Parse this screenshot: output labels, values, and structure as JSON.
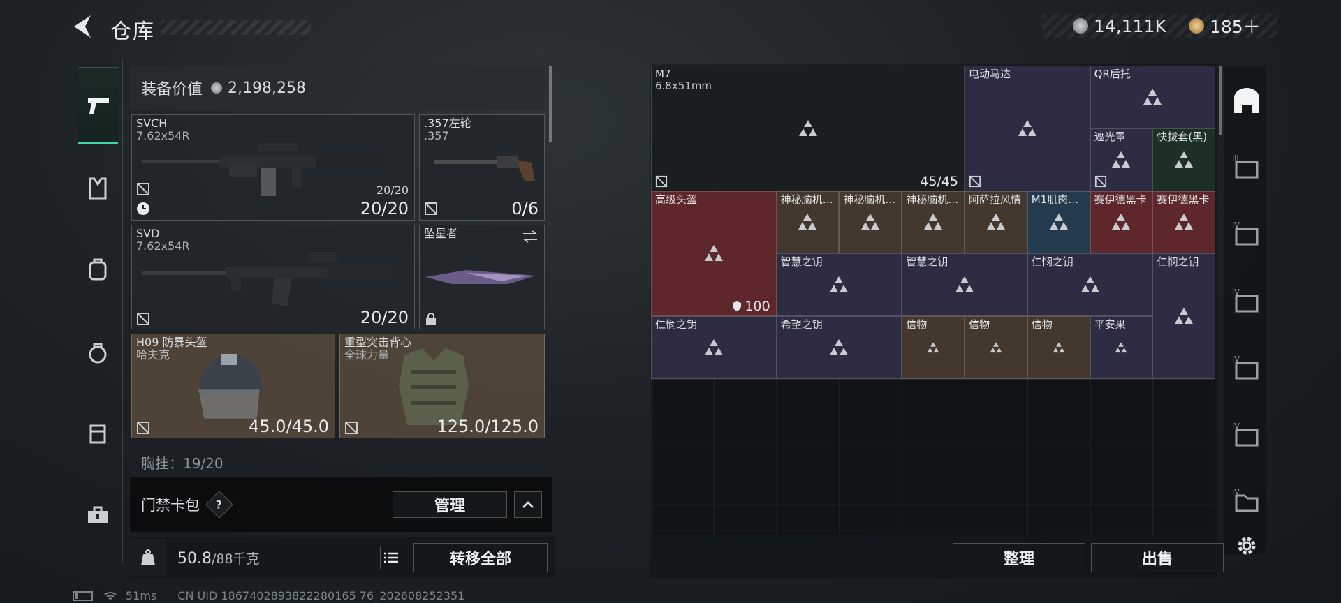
{
  "header": {
    "title": "仓库",
    "currency_silver": "14,111K",
    "currency_gold": "185＋"
  },
  "equipment": {
    "value_label": "装备价值",
    "value": "2,198,258",
    "primary": {
      "name": "SVCH",
      "caliber": "7.62x54R",
      "mag": "20/20",
      "ammo": "20/20"
    },
    "sidearm": {
      "name": ".357左轮",
      "caliber": ".357",
      "ammo": "0/6"
    },
    "secondary": {
      "name": "SVD",
      "caliber": "7.62x54R",
      "ammo": "20/20"
    },
    "melee": {
      "name": "坠星者"
    },
    "helmet": {
      "name": "H09 防暴头盔",
      "brand": "哈夫克",
      "durability": "45.0/45.0"
    },
    "armor": {
      "name": "重型突击背心",
      "brand": "全球力量",
      "durability": "125.0/125.0"
    },
    "chest_rig_label": "胸挂：19/20"
  },
  "card_pack": {
    "label": "门禁卡包",
    "help": "?",
    "manage": "管理"
  },
  "weight": {
    "current": "50.8",
    "max": "/88千克",
    "transfer_all": "转移全部"
  },
  "storage": {
    "cells": [
      {
        "label": "M7",
        "sub": "6.8x51mm",
        "count": "45/45",
        "color": "dark"
      },
      {
        "label": "电动马达",
        "color": "purple"
      },
      {
        "label": "QR后托",
        "color": "purple"
      },
      {
        "label": "遮光罩",
        "color": "purple"
      },
      {
        "label": "快拔套(黑)",
        "color": "green"
      },
      {
        "label": "高级头盔",
        "armor": "100",
        "color": "red"
      },
      {
        "label": "神秘脑机…",
        "color": "brown"
      },
      {
        "label": "神秘脑机…",
        "color": "brown"
      },
      {
        "label": "神秘脑机…",
        "color": "brown"
      },
      {
        "label": "阿萨拉风情",
        "color": "brown"
      },
      {
        "label": "M1肌肉…",
        "color": "blue"
      },
      {
        "label": "赛伊德黑卡",
        "color": "red"
      },
      {
        "label": "赛伊德黑卡",
        "color": "red"
      },
      {
        "label": "智慧之钥",
        "color": "purple"
      },
      {
        "label": "智慧之钥",
        "color": "purple"
      },
      {
        "label": "仁悯之钥",
        "color": "purple"
      },
      {
        "label": "仁悯之钥",
        "color": "purple"
      },
      {
        "label": "仁悯之钥",
        "color": "purple"
      },
      {
        "label": "希望之钥",
        "color": "purple"
      },
      {
        "label": "信物",
        "color": "brown"
      },
      {
        "label": "信物",
        "color": "brown"
      },
      {
        "label": "信物",
        "color": "brown"
      },
      {
        "label": "平安果",
        "color": "purple"
      }
    ],
    "sort_button": "整理",
    "sell_button": "出售"
  },
  "status_bar": {
    "ping": "51ms",
    "uid": "CN UID 1867402893822280165 76_202608252351"
  },
  "colors": {
    "accent_green": "#3fd7a6",
    "red_item": "#62282c",
    "purple_item": "#2f2d45"
  }
}
